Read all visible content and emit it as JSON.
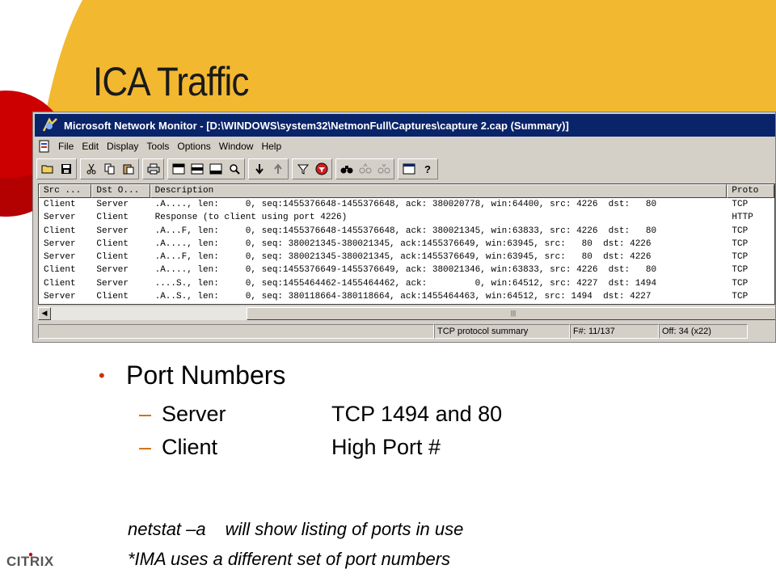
{
  "slide": {
    "title": "ICA Traffic",
    "logo_text": "CITRIX",
    "colors": {
      "accent_yellow": "#f2b830",
      "accent_red": "#cc0000",
      "bullet": "#cc3300",
      "dash": "#cc6600"
    }
  },
  "window": {
    "title": "Microsoft Network Monitor - [D:\\WINDOWS\\system32\\NetmonFull\\Captures\\capture 2.cap (Summary)]",
    "icons": {
      "app": "network-monitor-icon",
      "document": "document-icon"
    },
    "menu": [
      "File",
      "Edit",
      "Display",
      "Tools",
      "Options",
      "Window",
      "Help"
    ],
    "toolbar_icons": [
      "open-icon",
      "save-icon",
      "cut-icon",
      "copy-icon",
      "paste-icon",
      "print-icon",
      "pane-1-icon",
      "pane-2-icon",
      "pane-3-icon",
      "zoom-icon",
      "next-icon",
      "previous-icon",
      "filter-icon",
      "stop-filter-icon",
      "find-icon",
      "find-next-icon",
      "find-previous-icon",
      "window-icon",
      "help-icon"
    ],
    "columns": [
      "Src ...",
      "Dst O...",
      "Description",
      "Proto"
    ],
    "rows": [
      {
        "src": "Client",
        "dst": "Server",
        "desc": ".A...., len:     0, seq:1455376648-1455376648, ack: 380020778, win:64400, src: 4226  dst:   80",
        "proto": "TCP"
      },
      {
        "src": "Server",
        "dst": "Client",
        "desc": "Response (to client using port 4226)",
        "proto": "HTTP"
      },
      {
        "src": "Client",
        "dst": "Server",
        "desc": ".A...F, len:     0, seq:1455376648-1455376648, ack: 380021345, win:63833, src: 4226  dst:   80",
        "proto": "TCP"
      },
      {
        "src": "Server",
        "dst": "Client",
        "desc": ".A...., len:     0, seq: 380021345-380021345, ack:1455376649, win:63945, src:   80  dst: 4226",
        "proto": "TCP"
      },
      {
        "src": "Server",
        "dst": "Client",
        "desc": ".A...F, len:     0, seq: 380021345-380021345, ack:1455376649, win:63945, src:   80  dst: 4226",
        "proto": "TCP"
      },
      {
        "src": "Client",
        "dst": "Server",
        "desc": ".A...., len:     0, seq:1455376649-1455376649, ack: 380021346, win:63833, src: 4226  dst:   80",
        "proto": "TCP"
      },
      {
        "src": "Client",
        "dst": "Server",
        "desc": "....S., len:     0, seq:1455464462-1455464462, ack:         0, win:64512, src: 4227  dst: 1494",
        "proto": "TCP"
      },
      {
        "src": "Server",
        "dst": "Client",
        "desc": ".A..S., len:     0, seq: 380118664-380118664, ack:1455464463, win:64512, src: 1494  dst: 4227",
        "proto": "TCP"
      }
    ],
    "scroll_thumb_text": "|||",
    "status": {
      "summary": "TCP protocol summary",
      "frame": "F#: 11/137",
      "offset": "Off: 34 (x22)"
    }
  },
  "bullets": {
    "main": "Port Numbers",
    "server_label": "Server",
    "server_value": "TCP 1494 and 80",
    "client_label": "Client",
    "client_value": "High Port #",
    "dash": "–",
    "dot": "•"
  },
  "notes": {
    "command": "netstat –a",
    "command_desc": "will show listing of ports in use",
    "ima": "*IMA uses a different set of port numbers"
  }
}
